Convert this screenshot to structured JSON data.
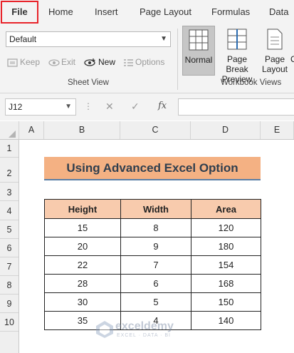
{
  "ribbon": {
    "tabs": [
      "File",
      "Home",
      "Insert",
      "Page Layout",
      "Formulas",
      "Data"
    ],
    "sheet_view": {
      "dropdown_value": "Default",
      "keep_label": "Keep",
      "exit_label": "Exit",
      "new_label": "New",
      "options_label": "Options",
      "group_label": "Sheet View"
    },
    "workbook_views": {
      "normal_label": "Normal",
      "page_break_line1": "Page Break",
      "page_break_line2": "Preview",
      "page_layout_line1": "Page",
      "page_layout_line2": "Layout",
      "custom_partial": "C",
      "group_label": "Workbook Views"
    }
  },
  "formula_bar": {
    "name_box": "J12",
    "fx_label": "fx",
    "formula": ""
  },
  "grid": {
    "columns": [
      "A",
      "B",
      "C",
      "D",
      "E"
    ],
    "rows": [
      "1",
      "2",
      "3",
      "4",
      "5",
      "6",
      "7",
      "8",
      "9",
      "10"
    ]
  },
  "sheet": {
    "title": "Using Advanced Excel Option",
    "table": {
      "headers": [
        "Height",
        "Width",
        "Area"
      ],
      "rows": [
        [
          "15",
          "8",
          "120"
        ],
        [
          "20",
          "9",
          "180"
        ],
        [
          "22",
          "7",
          "154"
        ],
        [
          "28",
          "6",
          "168"
        ],
        [
          "30",
          "5",
          "150"
        ],
        [
          "35",
          "4",
          "140"
        ]
      ]
    }
  },
  "watermark": {
    "name": "exceldemy",
    "tagline": "EXCEL · DATA · BI"
  },
  "colors": {
    "title_fill": "#f4b183",
    "header_fill": "#f8cbad",
    "file_tab_outline": "#e8232a",
    "title_underline": "#5b7fa6"
  }
}
